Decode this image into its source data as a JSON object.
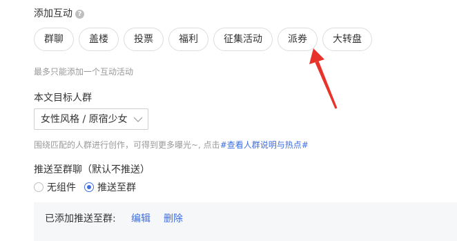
{
  "interaction": {
    "title": "添加互动",
    "help_icon_glyph": "?",
    "chips": [
      "群聊",
      "盖楼",
      "投票",
      "福利",
      "征集活动",
      "派券",
      "大转盘"
    ],
    "hint": "最多只能添加一个互动活动"
  },
  "audience": {
    "title": "本文目标人群",
    "select_value": "女性风格 / 原宿少女",
    "hint_prefix": "围绕匹配的人群进行创作，可得到更多曝光~, 点击",
    "hint_link": "#查看人群说明与热点#"
  },
  "push": {
    "title": "推送至群聊（默认不推送）",
    "options": [
      {
        "label": "无组件",
        "checked": false
      },
      {
        "label": "推送至群",
        "checked": true
      }
    ],
    "added_label": "已添加推送至群:",
    "edit_label": "编辑",
    "delete_label": "删除"
  },
  "colors": {
    "accent": "#3d6ee0",
    "annotation_arrow": "#e8332a"
  },
  "icons": [
    "question-mark-icon",
    "chevron-down-icon",
    "annotation-arrow-icon"
  ]
}
